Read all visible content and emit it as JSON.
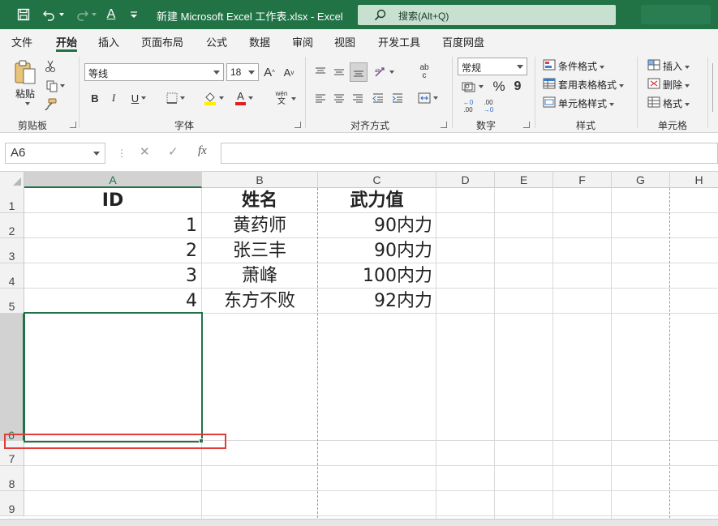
{
  "title_bar": {
    "title": "新建 Microsoft Excel 工作表.xlsx  -  Excel",
    "search_placeholder": "搜索(Alt+Q)",
    "font_color_letter": "A"
  },
  "tabs": [
    {
      "label": "文件",
      "active": false
    },
    {
      "label": "开始",
      "active": true
    },
    {
      "label": "插入",
      "active": false
    },
    {
      "label": "页面布局",
      "active": false
    },
    {
      "label": "公式",
      "active": false
    },
    {
      "label": "数据",
      "active": false
    },
    {
      "label": "审阅",
      "active": false
    },
    {
      "label": "视图",
      "active": false
    },
    {
      "label": "开发工具",
      "active": false
    },
    {
      "label": "百度网盘",
      "active": false
    }
  ],
  "ribbon": {
    "clipboard": {
      "paste_label": "粘贴",
      "group_label": "剪贴板"
    },
    "font": {
      "font_name": "等线",
      "font_size": "18",
      "grow_label": "A",
      "shrink_label": "A",
      "bold": "B",
      "italic": "I",
      "underline": "U",
      "color_letter": "A",
      "phonetic_top": "wén",
      "phonetic_bottom": "文",
      "group_label": "字体"
    },
    "alignment": {
      "wrap_top": "ab",
      "wrap_bottom": "c",
      "group_label": "对齐方式"
    },
    "number": {
      "format": "常规",
      "percent": "%",
      "comma": "9",
      "inc_top": "←0",
      "inc_bottom": ".00",
      "dec_top": ".00",
      "dec_bottom": "→0",
      "group_label": "数字"
    },
    "styles": {
      "conditional": "条件格式",
      "table": "套用表格格式",
      "cell": "单元格样式",
      "group_label": "样式"
    },
    "cells": {
      "insert": "插入",
      "delete": "删除",
      "format": "格式",
      "group_label": "单元格"
    }
  },
  "formula_bar": {
    "name_box": "A6",
    "fx": "fx",
    "cancel": "✕",
    "confirm": "✓",
    "formula": ""
  },
  "columns": [
    "A",
    "B",
    "C",
    "D",
    "E",
    "F",
    "G",
    "H"
  ],
  "rows": [
    "1",
    "2",
    "3",
    "4",
    "5",
    "6",
    "7",
    "8",
    "9"
  ],
  "table": {
    "headers": [
      "ID",
      "姓名",
      "武力值"
    ],
    "data": [
      [
        "1",
        "黄药师",
        "90内力"
      ],
      [
        "2",
        "张三丰",
        "90内力"
      ],
      [
        "3",
        "萧峰",
        "100内力"
      ],
      [
        "4",
        "东方不败",
        "92内力"
      ]
    ]
  },
  "selected_cell": "A6",
  "colors": {
    "accent": "#217346",
    "highlight": "#e03c3c"
  }
}
